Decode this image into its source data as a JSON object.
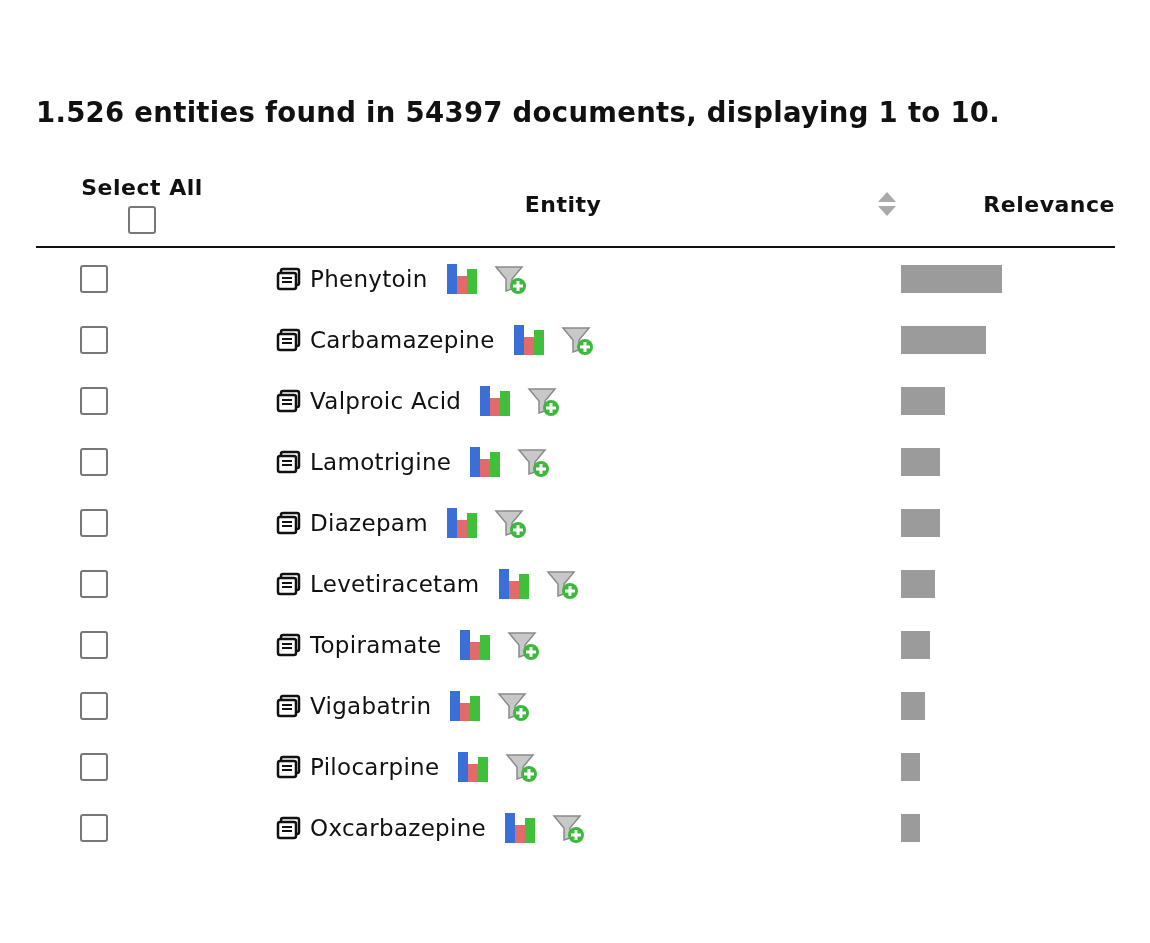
{
  "summary": "1.526 entities found in 54397 documents, displaying 1 to 10.",
  "table": {
    "select_all": {
      "label": "Select All",
      "checked": false
    },
    "columns": [
      "Entity",
      "Relevance"
    ],
    "rows": [
      {
        "entity": "Phenytoin",
        "checked": false
      },
      {
        "entity": "Carbamazepine",
        "checked": false
      },
      {
        "entity": "Valproic Acid",
        "checked": false
      },
      {
        "entity": "Lamotrigine",
        "checked": false
      },
      {
        "entity": "Diazepam",
        "checked": false
      },
      {
        "entity": "Levetiracetam",
        "checked": false
      },
      {
        "entity": "Topiramate",
        "checked": false
      },
      {
        "entity": "Vigabatrin",
        "checked": false
      },
      {
        "entity": "Pilocarpine",
        "checked": false
      },
      {
        "entity": "Oxcarbazepine",
        "checked": false
      }
    ]
  }
}
